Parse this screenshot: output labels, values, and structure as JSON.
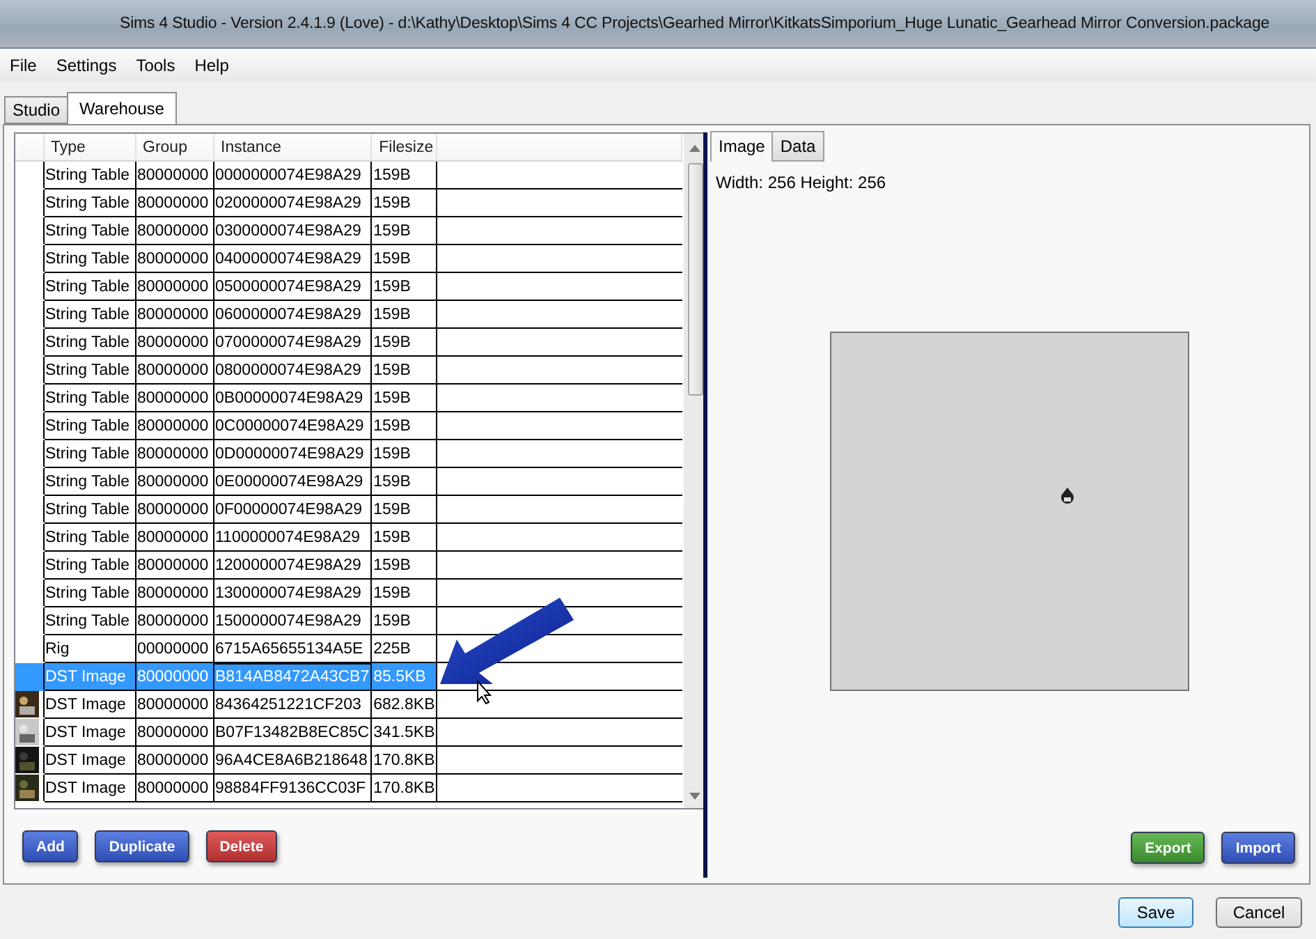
{
  "window": {
    "title": "Sims 4 Studio - Version 2.4.1.9  (Love)   - d:\\Kathy\\Desktop\\Sims 4 CC Projects\\Gearhed Mirror\\KitkatsSimporium_Huge Lunatic_Gearhead Mirror Conversion.package"
  },
  "menu": [
    "File",
    "Settings",
    "Tools",
    "Help"
  ],
  "tabs": [
    {
      "label": "Studio",
      "selected": false
    },
    {
      "label": "Warehouse",
      "selected": true
    }
  ],
  "table": {
    "columns": [
      "Type",
      "Group",
      "Instance",
      "Filesize"
    ],
    "rows": [
      {
        "type": "String Table",
        "group": "80000000",
        "instance": "0000000074E98A29",
        "filesize": "159B",
        "selected": false,
        "thumbnail": false
      },
      {
        "type": "String Table",
        "group": "80000000",
        "instance": "0200000074E98A29",
        "filesize": "159B",
        "selected": false,
        "thumbnail": false
      },
      {
        "type": "String Table",
        "group": "80000000",
        "instance": "0300000074E98A29",
        "filesize": "159B",
        "selected": false,
        "thumbnail": false
      },
      {
        "type": "String Table",
        "group": "80000000",
        "instance": "0400000074E98A29",
        "filesize": "159B",
        "selected": false,
        "thumbnail": false
      },
      {
        "type": "String Table",
        "group": "80000000",
        "instance": "0500000074E98A29",
        "filesize": "159B",
        "selected": false,
        "thumbnail": false
      },
      {
        "type": "String Table",
        "group": "80000000",
        "instance": "0600000074E98A29",
        "filesize": "159B",
        "selected": false,
        "thumbnail": false
      },
      {
        "type": "String Table",
        "group": "80000000",
        "instance": "0700000074E98A29",
        "filesize": "159B",
        "selected": false,
        "thumbnail": false
      },
      {
        "type": "String Table",
        "group": "80000000",
        "instance": "0800000074E98A29",
        "filesize": "159B",
        "selected": false,
        "thumbnail": false
      },
      {
        "type": "String Table",
        "group": "80000000",
        "instance": "0B00000074E98A29",
        "filesize": "159B",
        "selected": false,
        "thumbnail": false
      },
      {
        "type": "String Table",
        "group": "80000000",
        "instance": "0C00000074E98A29",
        "filesize": "159B",
        "selected": false,
        "thumbnail": false
      },
      {
        "type": "String Table",
        "group": "80000000",
        "instance": "0D00000074E98A29",
        "filesize": "159B",
        "selected": false,
        "thumbnail": false
      },
      {
        "type": "String Table",
        "group": "80000000",
        "instance": "0E00000074E98A29",
        "filesize": "159B",
        "selected": false,
        "thumbnail": false
      },
      {
        "type": "String Table",
        "group": "80000000",
        "instance": "0F00000074E98A29",
        "filesize": "159B",
        "selected": false,
        "thumbnail": false
      },
      {
        "type": "String Table",
        "group": "80000000",
        "instance": "1100000074E98A29",
        "filesize": "159B",
        "selected": false,
        "thumbnail": false
      },
      {
        "type": "String Table",
        "group": "80000000",
        "instance": "1200000074E98A29",
        "filesize": "159B",
        "selected": false,
        "thumbnail": false
      },
      {
        "type": "String Table",
        "group": "80000000",
        "instance": "1300000074E98A29",
        "filesize": "159B",
        "selected": false,
        "thumbnail": false
      },
      {
        "type": "String Table",
        "group": "80000000",
        "instance": "1500000074E98A29",
        "filesize": "159B",
        "selected": false,
        "thumbnail": false
      },
      {
        "type": "Rig",
        "group": "00000000",
        "instance": "6715A65655134A5E",
        "filesize": "225B",
        "selected": false,
        "thumbnail": false
      },
      {
        "type": "DST Image",
        "group": "80000000",
        "instance": "B814AB8472A43CB7",
        "filesize": "85.5KB",
        "selected": true,
        "thumbnail": false
      },
      {
        "type": "DST Image",
        "group": "80000000",
        "instance": "84364251221CF203",
        "filesize": "682.8KB",
        "selected": false,
        "thumbnail": true
      },
      {
        "type": "DST Image",
        "group": "80000000",
        "instance": "B07F13482B8EC85C",
        "filesize": "341.5KB",
        "selected": false,
        "thumbnail": true
      },
      {
        "type": "DST Image",
        "group": "80000000",
        "instance": "96A4CE8A6B218648",
        "filesize": "170.8KB",
        "selected": false,
        "thumbnail": true
      },
      {
        "type": "DST Image",
        "group": "80000000",
        "instance": "98884FF9136CC03F",
        "filesize": "170.8KB",
        "selected": false,
        "thumbnail": true
      }
    ]
  },
  "left_buttons": [
    {
      "label": "Add",
      "kind": "blue"
    },
    {
      "label": "Duplicate",
      "kind": "blue"
    },
    {
      "label": "Delete",
      "kind": "red"
    }
  ],
  "preview": {
    "tabs": [
      {
        "label": "Image",
        "selected": true
      },
      {
        "label": "Data",
        "selected": false
      }
    ],
    "dimensions": "Width: 256 Height: 256"
  },
  "right_buttons": [
    {
      "label": "Export",
      "kind": "green"
    },
    {
      "label": "Import",
      "kind": "blue"
    }
  ],
  "footer_buttons": [
    {
      "label": "Save",
      "kind": "default"
    },
    {
      "label": "Cancel",
      "kind": "plain"
    }
  ]
}
